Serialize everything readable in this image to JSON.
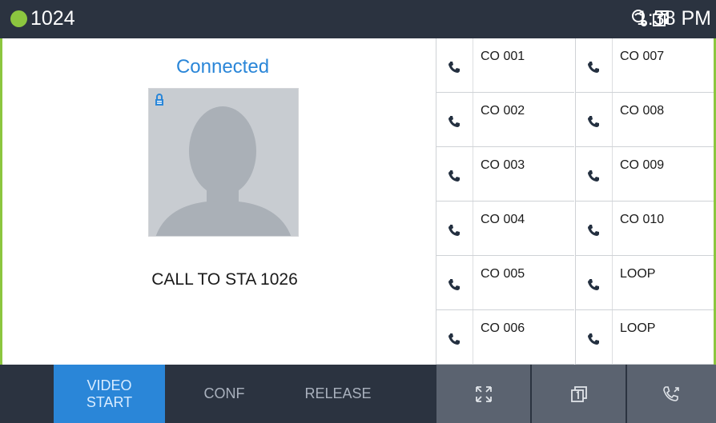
{
  "status": {
    "extension": "1024",
    "time": "1:38 PM",
    "accent": "#8cc63f",
    "icons": [
      "phone-settings-icon",
      "one-screen-icon"
    ]
  },
  "call": {
    "status": "Connected",
    "status_color": "#2a86d8",
    "text": "CALL TO STA 1026"
  },
  "trunks": {
    "left": [
      "CO 001",
      "CO 002",
      "CO 003",
      "CO 004",
      "CO 005",
      "CO 006"
    ],
    "right": [
      "CO 007",
      "CO 008",
      "CO 009",
      "CO 010",
      "LOOP",
      "LOOP"
    ]
  },
  "softkeys": {
    "video_line1": "VIDEO",
    "video_line2": "START",
    "conf": "CONF",
    "release": "RELEASE"
  },
  "right_buttons": [
    "fullscreen-icon",
    "one-screen-icon",
    "call-forward-icon"
  ]
}
